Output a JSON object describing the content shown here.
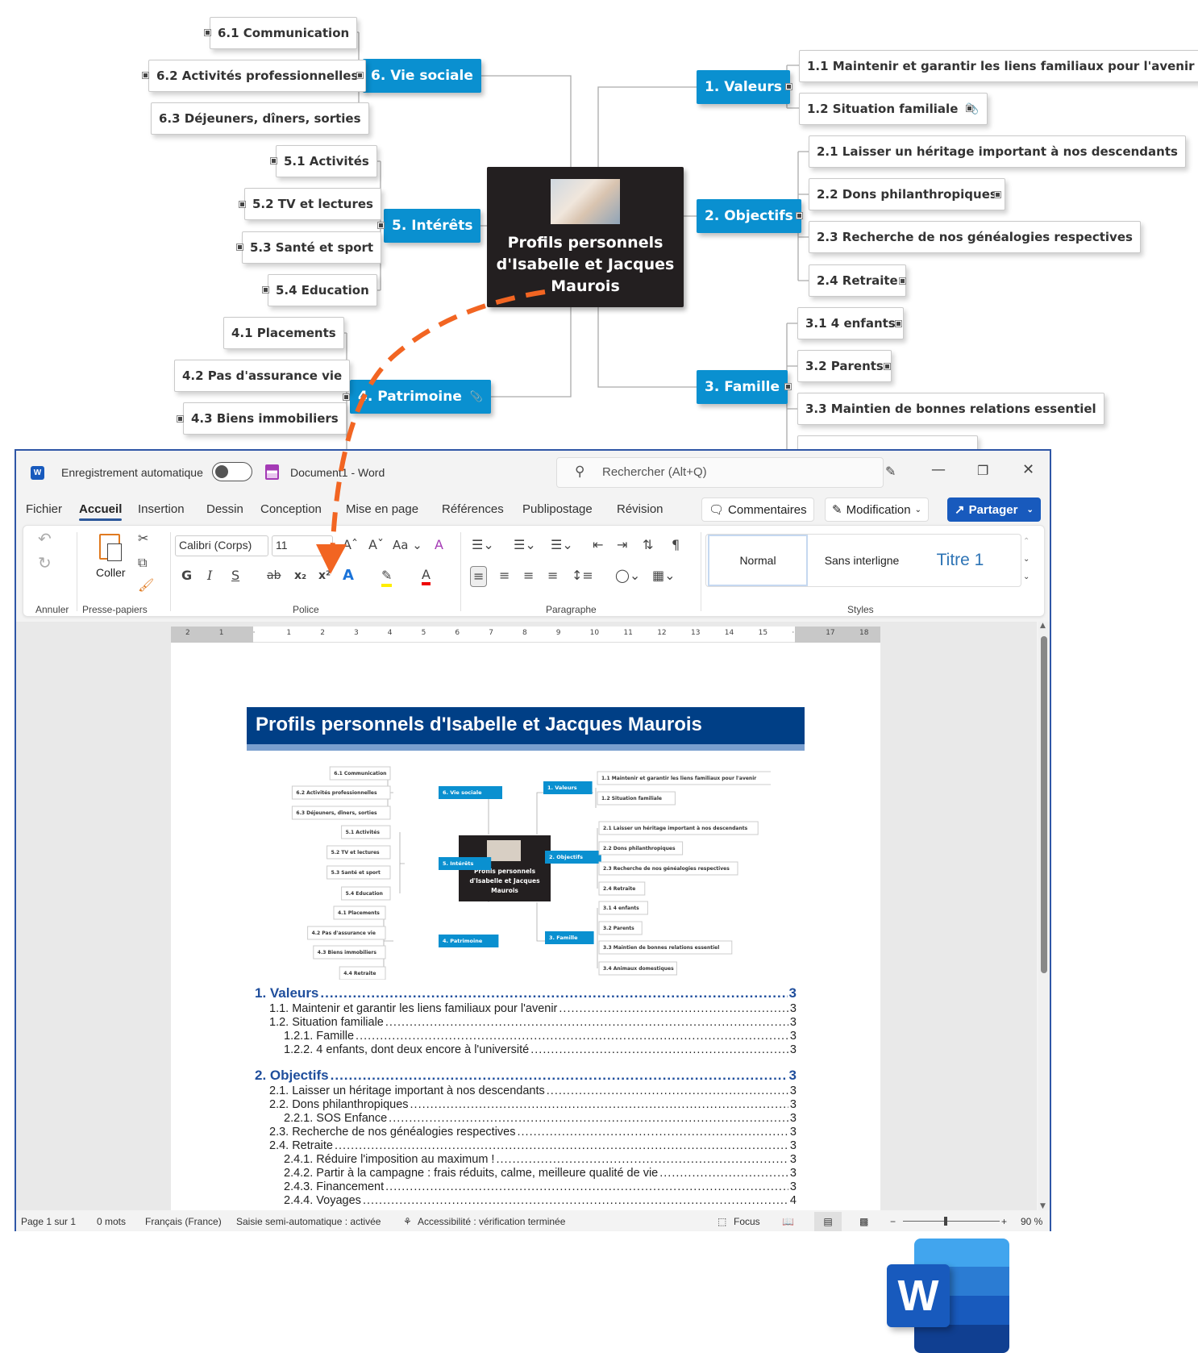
{
  "mindmap": {
    "center": "Profils personnels d'Isabelle et Jacques Maurois",
    "center_lines": [
      "Profils personnels",
      "d'Isabelle et Jacques",
      "Maurois"
    ],
    "branches": [
      {
        "label": "1.  Valeurs",
        "children": [
          "1.1  Maintenir et garantir les liens familiaux pour l'avenir",
          "1.2  Situation familiale"
        ]
      },
      {
        "label": "2.  Objectifs",
        "children": [
          "2.1  Laisser un héritage important à nos descendants",
          "2.2  Dons philanthropiques",
          "2.3  Recherche de nos généalogies respectives",
          "2.4  Retraite"
        ]
      },
      {
        "label": "3.  Famille",
        "children": [
          "3.1  4 enfants",
          "3.2  Parents",
          "3.3  Maintien de bonnes relations essentiel",
          "3.4  Animaux domestiques"
        ]
      },
      {
        "label": "4.  Patrimoine",
        "children": [
          "4.1  Placements",
          "4.2  Pas d'assurance vie",
          "4.3  Biens immobiliers",
          "4.4  Retraite"
        ]
      },
      {
        "label": "5.  Intérêts",
        "children": [
          "5.1  Activités",
          "5.2  TV et lectures",
          "5.3  Santé et sport",
          "5.4  Education"
        ]
      },
      {
        "label": "6.  Vie sociale",
        "children": [
          "6.1  Communication",
          "6.2  Activités professionnelles",
          "6.3  Déjeuners, dîners, sorties"
        ]
      }
    ],
    "attachment_icon": "paperclip-icon",
    "arrow_color": "#f26522",
    "branch_color": "#0a90d0"
  },
  "word": {
    "autosave_label": "Enregistrement automatique",
    "autosave_on": false,
    "doc_title": "Document1  -  Word",
    "search_placeholder": "Rechercher (Alt+Q)",
    "tabs": [
      "Fichier",
      "Accueil",
      "Insertion",
      "Dessin",
      "Conception",
      "Mise en page",
      "Références",
      "Publipostage",
      "Révision"
    ],
    "active_tab": "Accueil",
    "comments_label": "Commentaires",
    "editing_label": "Modification",
    "share_label": "Partager",
    "ribbon": {
      "undo_group": "Annuler",
      "paste_label": "Coller",
      "clipboard_group": "Presse-papiers",
      "font_name": "Calibri (Corps)",
      "font_size": "11",
      "font_group": "Police",
      "bold": "G",
      "italic": "I",
      "underline": "S",
      "strike": "ab",
      "change_case": "Aa",
      "paragraph_group": "Paragraphe",
      "styles_group": "Styles",
      "styles": [
        "Normal",
        "Sans interligne",
        "Titre 1"
      ],
      "selected_style": "Normal"
    },
    "ruler_ticks": [
      "2",
      "1",
      "",
      "1",
      "2",
      "3",
      "4",
      "5",
      "6",
      "7",
      "8",
      "9",
      "10",
      "11",
      "12",
      "13",
      "14",
      "15",
      "",
      "17",
      "18"
    ],
    "document": {
      "title": "Profils personnels d'Isabelle et Jacques Maurois",
      "toc": [
        {
          "level": 1,
          "label": "1. Valeurs",
          "page": "3"
        },
        {
          "level": 2,
          "label": "1.1. Maintenir et garantir les liens familiaux pour l'avenir",
          "page": "3"
        },
        {
          "level": 2,
          "label": "1.2. Situation familiale",
          "page": "3"
        },
        {
          "level": 3,
          "label": "1.2.1. Famille",
          "page": "3"
        },
        {
          "level": 3,
          "label": "1.2.2. 4 enfants, dont deux encore à l'université",
          "page": "3"
        },
        {
          "level": 1,
          "label": "2. Objectifs",
          "page": "3"
        },
        {
          "level": 2,
          "label": "2.1. Laisser un héritage important à nos descendants",
          "page": "3"
        },
        {
          "level": 2,
          "label": "2.2. Dons philanthropiques",
          "page": "3"
        },
        {
          "level": 3,
          "label": "2.2.1. SOS Enfance",
          "page": "3"
        },
        {
          "level": 2,
          "label": "2.3. Recherche de nos généalogies respectives",
          "page": "3"
        },
        {
          "level": 2,
          "label": "2.4. Retraite",
          "page": "3"
        },
        {
          "level": 3,
          "label": "2.4.1. Réduire l'imposition au maximum !",
          "page": "3"
        },
        {
          "level": 3,
          "label": "2.4.2. Partir à la campagne : frais réduits, calme, meilleure qualité de vie",
          "page": "3"
        },
        {
          "level": 3,
          "label": "2.4.3. Financement",
          "page": "3"
        },
        {
          "level": 3,
          "label": "2.4.4. Voyages",
          "page": "4"
        }
      ]
    },
    "status": {
      "page": "Page 1 sur 1",
      "words": "0 mots",
      "language": "Français (France)",
      "autocomplete": "Saisie semi-automatique : activée",
      "accessibility": "Accessibilité : vérification terminée",
      "focus": "Focus",
      "zoom": "90 %",
      "zoom_percent": 90
    }
  }
}
